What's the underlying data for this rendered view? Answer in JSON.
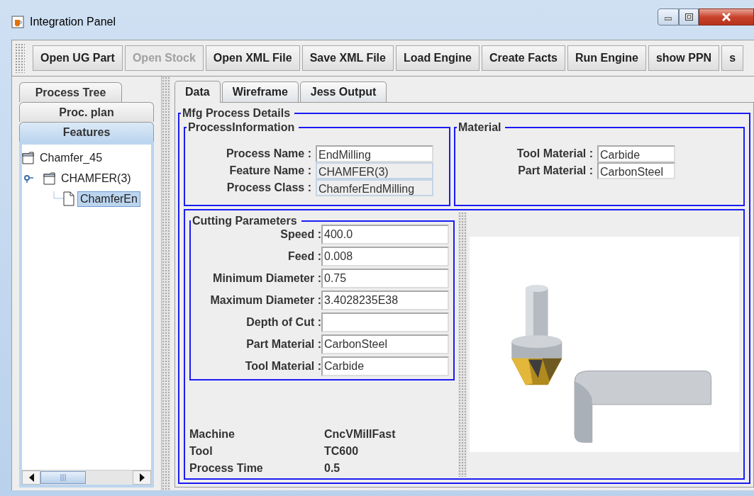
{
  "window": {
    "title": "Integration Panel"
  },
  "toolbar": [
    {
      "label": "Open UG Part",
      "disabled": false
    },
    {
      "label": "Open Stock",
      "disabled": true
    },
    {
      "label": "Open XML File",
      "disabled": false
    },
    {
      "label": "Save XML File",
      "disabled": false
    },
    {
      "label": "Load Engine",
      "disabled": false
    },
    {
      "label": "Create Facts",
      "disabled": false
    },
    {
      "label": "Run Engine",
      "disabled": false
    },
    {
      "label": "show PPN",
      "disabled": false
    },
    {
      "label": "s",
      "disabled": false
    }
  ],
  "left_tabs": [
    {
      "label": "Process Tree",
      "selected": false
    },
    {
      "label": "Proc. plan",
      "selected": false
    },
    {
      "label": "Features",
      "selected": true
    }
  ],
  "tree": [
    {
      "label": "Chamfer_45",
      "kind": "folder",
      "selected": false,
      "children": [
        {
          "label": "CHAMFER(3)",
          "kind": "folder",
          "selected": false,
          "expanded": true,
          "children": [
            {
              "label": "ChamferEn",
              "kind": "file",
              "selected": true
            }
          ]
        }
      ]
    }
  ],
  "right_tabs": [
    {
      "label": "Data",
      "selected": true
    },
    {
      "label": "Wireframe",
      "selected": false
    },
    {
      "label": "Jess Output",
      "selected": false
    }
  ],
  "details": {
    "title": "Mfg Process Details",
    "process_information": {
      "title": "ProcessInformation",
      "fields": [
        {
          "label": "Process Name :",
          "value": "EndMilling",
          "editable": true
        },
        {
          "label": "Feature Name :",
          "value": "CHAMFER(3)",
          "editable": false
        },
        {
          "label": "Process Class :",
          "value": "ChamferEndMilling",
          "editable": false
        }
      ]
    },
    "material": {
      "title": "Material",
      "fields": [
        {
          "label": "Tool Material :",
          "value": "Carbide",
          "editable": true
        },
        {
          "label": "Part Material :",
          "value": "CarbonSteel",
          "editable": true
        }
      ]
    },
    "cutting_parameters": {
      "title": "Cutting Parameters",
      "fields": [
        {
          "label": "Speed :",
          "value": "400.0",
          "editable": true
        },
        {
          "label": "Feed :",
          "value": "0.008",
          "editable": true
        },
        {
          "label": "Minimum Diameter :",
          "value": "0.75",
          "editable": true
        },
        {
          "label": "Maximum Diameter :",
          "value": "3.4028235E38",
          "editable": true
        },
        {
          "label": "Depth of Cut :",
          "editable": true
        },
        {
          "label": "Part Material :",
          "value": "CarbonSteel",
          "editable": true
        },
        {
          "label": "Tool Material :",
          "value": "Carbide",
          "editable": true
        }
      ]
    },
    "summary": [
      {
        "label": "Machine",
        "value": "CncVMillFast"
      },
      {
        "label": "Tool",
        "value": "TC600"
      },
      {
        "label": "Process Time",
        "value": "0.5"
      }
    ]
  }
}
